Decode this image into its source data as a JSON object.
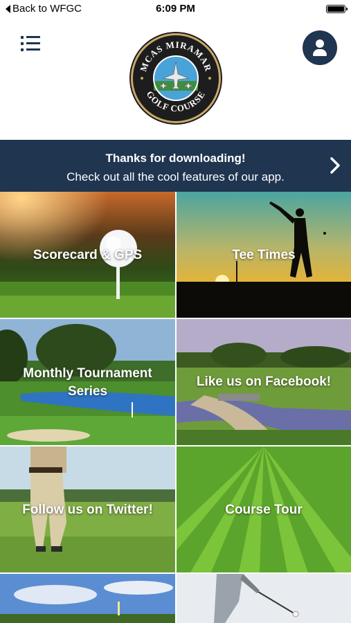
{
  "status_bar": {
    "back_label": "Back to WFGC",
    "time": "6:09 PM",
    "battery_level": 1.0
  },
  "header": {
    "menu_icon": "hamburger-menu-icon",
    "profile_icon": "user-profile-icon",
    "logo": {
      "top_text": "MCAS MIRAMAR",
      "bottom_text": "GOLF COURSE"
    }
  },
  "banner": {
    "title": "Thanks for downloading!",
    "subtitle": "Check out all the cool features of our app.",
    "chevron_icon": "chevron-right-icon"
  },
  "tiles": [
    {
      "label": "Scorecard & GPS"
    },
    {
      "label": "Tee Times"
    },
    {
      "label": "Monthly Tournament Series"
    },
    {
      "label": "Like us on Facebook!"
    },
    {
      "label": "Follow us on Twitter!"
    },
    {
      "label": "Course Tour"
    },
    {
      "label": ""
    },
    {
      "label": ""
    }
  ],
  "colors": {
    "navy": "#1f3550",
    "white": "#ffffff"
  }
}
